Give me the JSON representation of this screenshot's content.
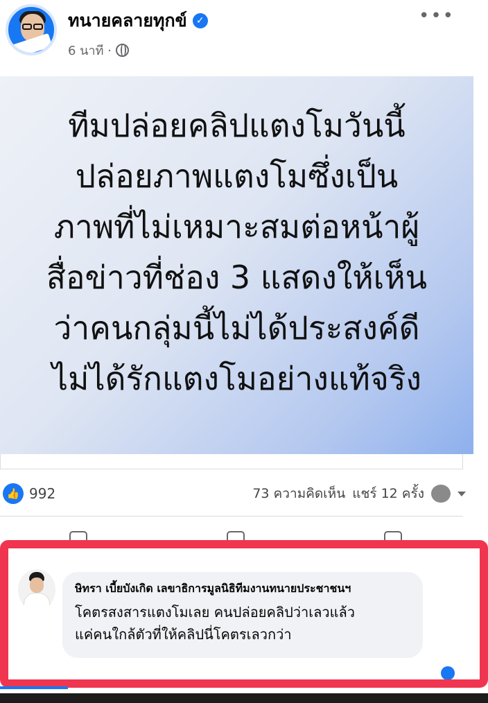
{
  "post": {
    "author": "ทนายคลายทุกข์",
    "time": "6 นาที ·",
    "image_text": "ทีมปล่อยคลิปแตงโมวันนี้\nปล่อยภาพแตงโมซึ่งเป็น\nภาพที่ไม่เหมาะสมต่อหน้าผู้\nสื่อข่าวที่ช่อง 3 แสดงให้เห็น\nว่าคนกลุ่มนี้ไม่ได้ประสงค์ดี\nไม่ได้รักแตงโมอย่างแท้จริง"
  },
  "stats": {
    "likes": "992",
    "comments": "73 ความคิดเห็น",
    "shares": "แชร์ 12 ครั้ง"
  },
  "comment": {
    "author": "ษิทรา เบี้ยบังเกิด เลขาธิการมูลนิธิทีมงานทนายประชาชนฯ",
    "line1": "โคตรสงสารแตงโมเลย คนปล่อยคลิปว่าเลวแล้ว",
    "line2": "แค่คนใกล้ตัวที่ให้คลิปนี่โคตรเลวกว่า"
  },
  "colors": {
    "highlight": "#f03550",
    "facebook_blue": "#1877f2"
  }
}
